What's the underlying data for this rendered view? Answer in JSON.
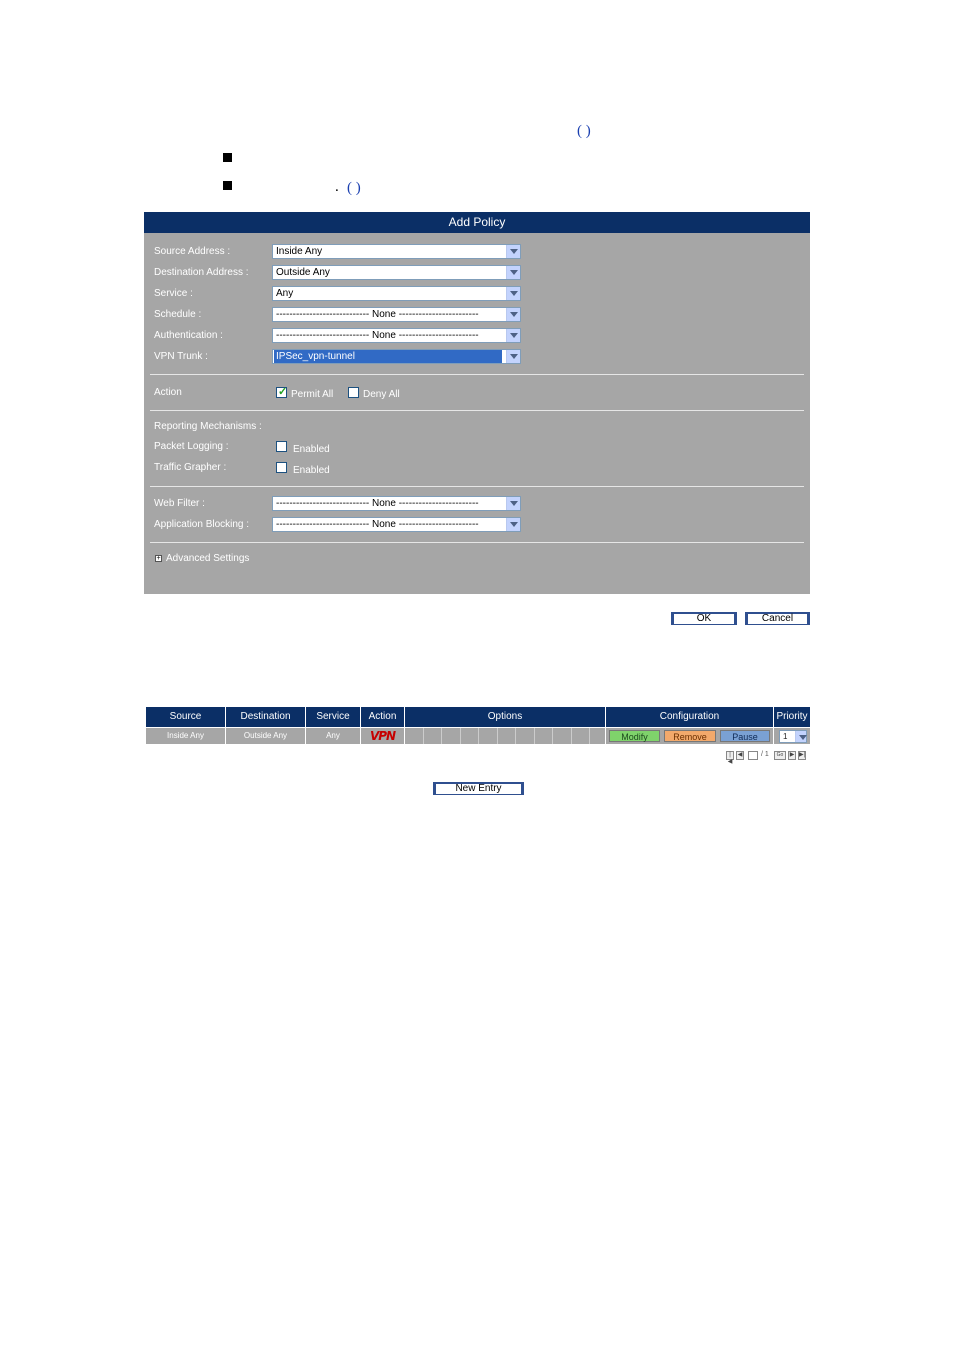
{
  "doc": {
    "paren1": "(                )",
    "paren2": "(                )",
    "dot": "."
  },
  "add_policy": {
    "title": "Add Policy",
    "fields": [
      {
        "label": "Source Address :",
        "value": "Inside Any"
      },
      {
        "label": "Destination Address :",
        "value": "Outside Any"
      },
      {
        "label": "Service :",
        "value": "Any"
      },
      {
        "label": "Schedule :",
        "value": "---------------------------- None ------------------------"
      },
      {
        "label": "Authentication :",
        "value": "---------------------------- None ------------------------"
      },
      {
        "label": "VPN Trunk :",
        "value": "IPSec_vpn-tunnel"
      }
    ],
    "action": {
      "label": "Action",
      "permit_label": "Permit All",
      "permit_checked": true,
      "deny_label": "Deny All",
      "deny_checked": false
    },
    "reporting": {
      "heading": "Reporting Mechanisms :",
      "packet_logging_label": "Packet Logging :",
      "packet_logging_option": "Enabled",
      "traffic_grapher_label": "Traffic Grapher :",
      "traffic_grapher_option": "Enabled"
    },
    "filters": [
      {
        "label": "Web Filter :",
        "value": "---------------------------- None ------------------------"
      },
      {
        "label": "Application Blocking :",
        "value": "---------------------------- None ------------------------"
      }
    ],
    "advanced_label": "Advanced Settings",
    "ok_label": "OK",
    "cancel_label": "Cancel"
  },
  "policy_table": {
    "headers": {
      "source": "Source",
      "destination": "Destination",
      "service": "Service",
      "action": "Action",
      "options": "Options",
      "configuration": "Configuration",
      "priority": "Priority"
    },
    "row": {
      "source": "Inside Any",
      "destination": "Outside Any",
      "service": "Any",
      "action": "VPN",
      "modify": "Modify",
      "remove": "Remove",
      "pause": "Pause",
      "priority": "1"
    },
    "pager": {
      "page": "1",
      "total": "/ 1",
      "go": "Go"
    },
    "new_entry_label": "New Entry"
  },
  "colors": {
    "header_bg": "#0b2f66",
    "panel_bg": "#a6a6a6",
    "modify_bg": "#7fd36b",
    "remove_bg": "#f2a96b",
    "pause_bg": "#7aa1d4",
    "vpn_red": "#c60000"
  }
}
